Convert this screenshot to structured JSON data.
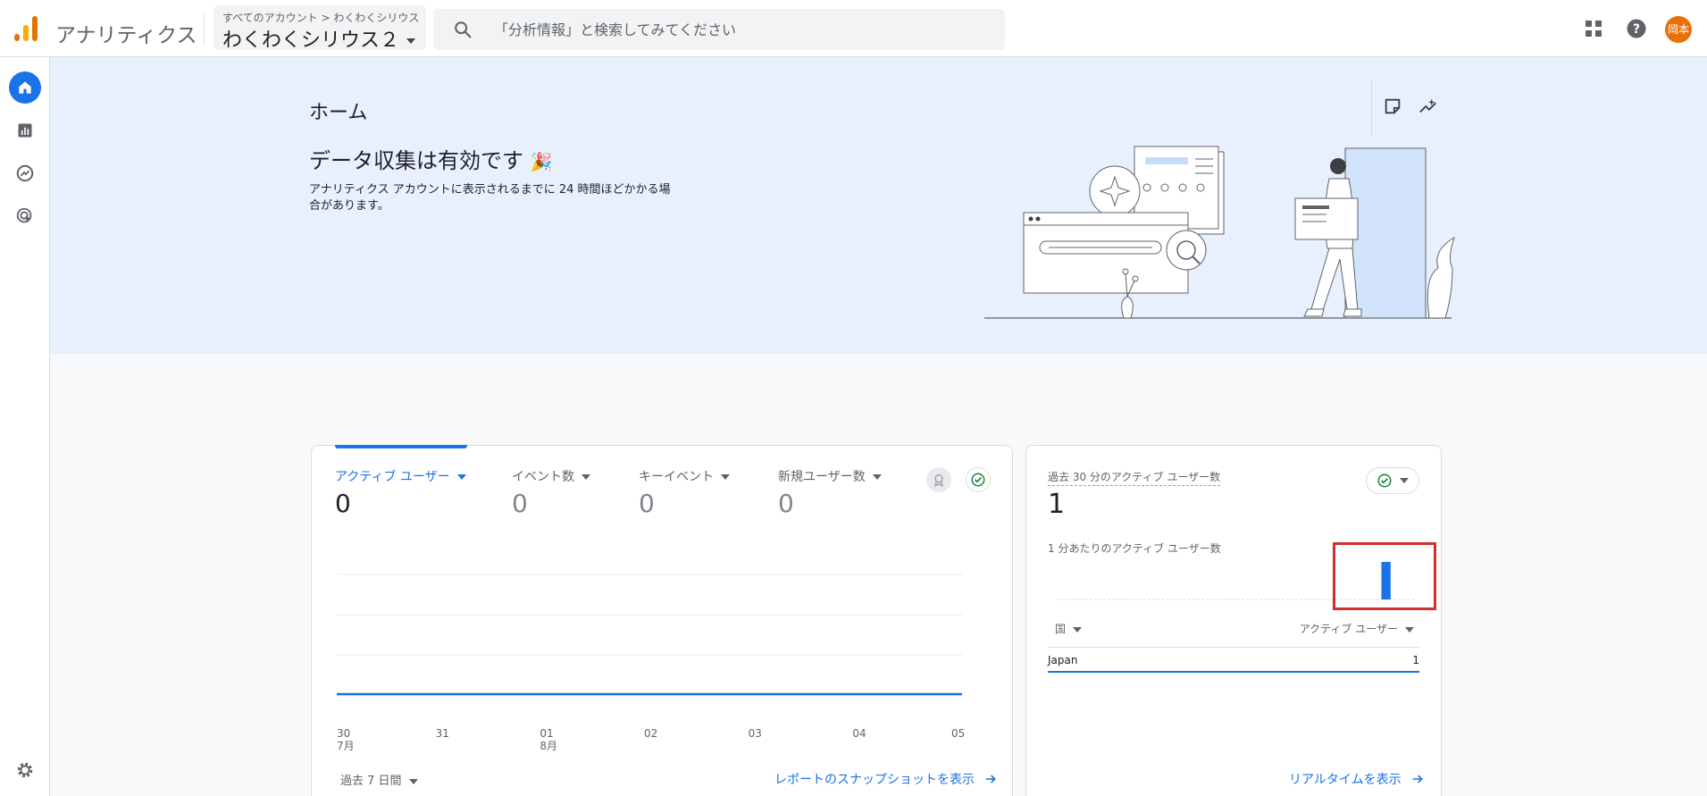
{
  "app": {
    "brand": "アナリティクス",
    "breadcrumb_all": "すべてのアカウント",
    "breadcrumb_sep": ">",
    "breadcrumb_account": "わくわくシリウス",
    "property": "わくわくシリウス２",
    "search_placeholder": "「分析情報」と検索してみてください",
    "avatar_text": "岡本"
  },
  "colors": {
    "accent": "#1a73e8",
    "hero_bg": "#e8f0fe",
    "avatar": "#e8710a",
    "highlight": "#d32f2f"
  },
  "icons": {
    "logo": "analytics-logo-icon",
    "search": "search-icon",
    "apps": "apps-grid-icon",
    "help": "help-icon",
    "rail": [
      "home-icon",
      "reports-icon",
      "explore-icon",
      "advertising-icon",
      "settings-icon"
    ],
    "hero_tools": [
      "notes-icon",
      "insights-icon"
    ]
  },
  "hero": {
    "page_title": "ホーム",
    "title": "データ収集は有効です",
    "emoji": "🎉",
    "description": "アナリティクス アカウントに表示されるまでに 24 時間ほどかかる場合があります。"
  },
  "overview": {
    "metrics": [
      {
        "label": "アクティブ ユーザー",
        "value": "0"
      },
      {
        "label": "イベント数",
        "value": "0"
      },
      {
        "label": "キーイベント",
        "value": "0"
      },
      {
        "label": "新規ユーザー数",
        "value": "0"
      }
    ],
    "range": "過去 7 日間",
    "report_link": "レポートのスナップショットを表示"
  },
  "chart_data": [
    {
      "type": "line",
      "x": [
        "30",
        "31",
        "01",
        "02",
        "03",
        "04",
        "05"
      ],
      "month_labels": {
        "0": "7月",
        "2": "8月"
      },
      "series": [
        {
          "values": [
            0,
            0,
            0,
            0,
            0,
            0,
            0
          ]
        }
      ],
      "grid": true
    },
    {
      "type": "bar",
      "title": "1 分あたりのアクティブ ユーザー数",
      "x_count": 30,
      "values_last": 1,
      "values": [
        0,
        0,
        0,
        0,
        0,
        0,
        0,
        0,
        0,
        0,
        0,
        0,
        0,
        0,
        0,
        0,
        0,
        0,
        0,
        0,
        0,
        0,
        0,
        0,
        0,
        0,
        0,
        1,
        0,
        0
      ]
    }
  ],
  "realtime": {
    "label": "過去 30 分のアクティブ ユーザー数",
    "value": "1",
    "sub_label": "1 分あたりのアクティブ ユーザー数",
    "col_country": "国",
    "col_users": "アクティブ ユーザー",
    "rows": [
      {
        "country": "Japan",
        "users": "1"
      }
    ],
    "link": "リアルタイムを表示"
  }
}
